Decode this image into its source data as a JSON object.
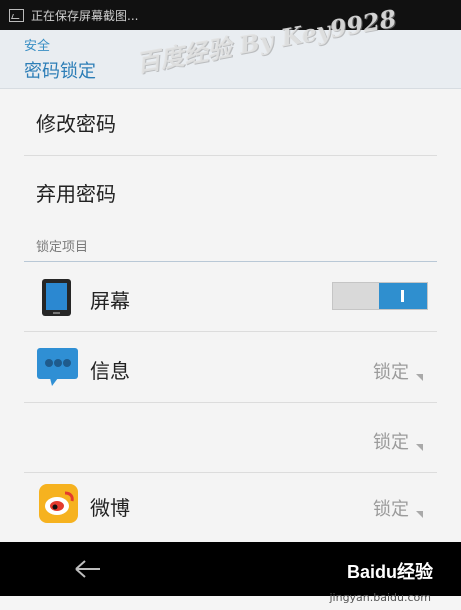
{
  "status": {
    "text": "正在保存屏幕截图..."
  },
  "header": {
    "breadcrumb": "安全",
    "title": "密码锁定"
  },
  "watermark": {
    "text": "百度经验 By Key9928"
  },
  "actions": [
    {
      "label": "修改密码"
    },
    {
      "label": "弃用密码"
    }
  ],
  "section": {
    "label": "锁定项目"
  },
  "items": [
    {
      "label": "屏幕",
      "icon": "tablet-icon",
      "toggle": true
    },
    {
      "label": "信息",
      "icon": "messages-icon",
      "value": "锁定"
    },
    {
      "label": "",
      "value": "锁定"
    },
    {
      "label": "微博",
      "icon": "weibo-icon",
      "value": "锁定"
    }
  ],
  "footer": {
    "logo": "Baidu经验",
    "site": "jingyan.baidu.com"
  },
  "colors": {
    "accent": "#2f8fcf",
    "header": "#2d7eb7",
    "background": "#f4f4f4"
  }
}
